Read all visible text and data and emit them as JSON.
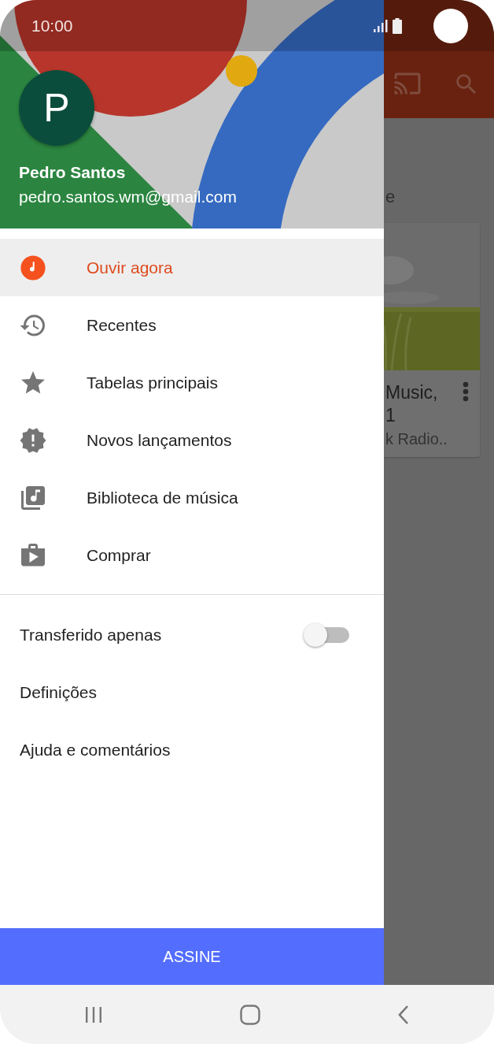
{
  "status_bar": {
    "time": "10:00"
  },
  "drawer": {
    "account": {
      "initial": "P",
      "name": "Pedro Santos",
      "email": "pedro.santos.wm@gmail.com"
    },
    "items": [
      {
        "label": "Ouvir agora",
        "selected": true
      },
      {
        "label": "Recentes",
        "selected": false
      },
      {
        "label": "Tabelas principais",
        "selected": false
      },
      {
        "label": "Novos lançamentos",
        "selected": false
      },
      {
        "label": "Biblioteca de música",
        "selected": false
      },
      {
        "label": "Comprar",
        "selected": false
      }
    ],
    "secondary_items": [
      {
        "kind": "toggle",
        "label": "Transferido apenas",
        "on": false
      },
      {
        "kind": "link",
        "label": "Definições"
      },
      {
        "kind": "link",
        "label": "Ajuda e comentários"
      }
    ],
    "subscribe_button": "ASSINE"
  },
  "background_app": {
    "heading_fragment": "e",
    "card": {
      "title_lines": [
        "Music,",
        "1"
      ],
      "subtitle": "k Radio.."
    }
  }
}
